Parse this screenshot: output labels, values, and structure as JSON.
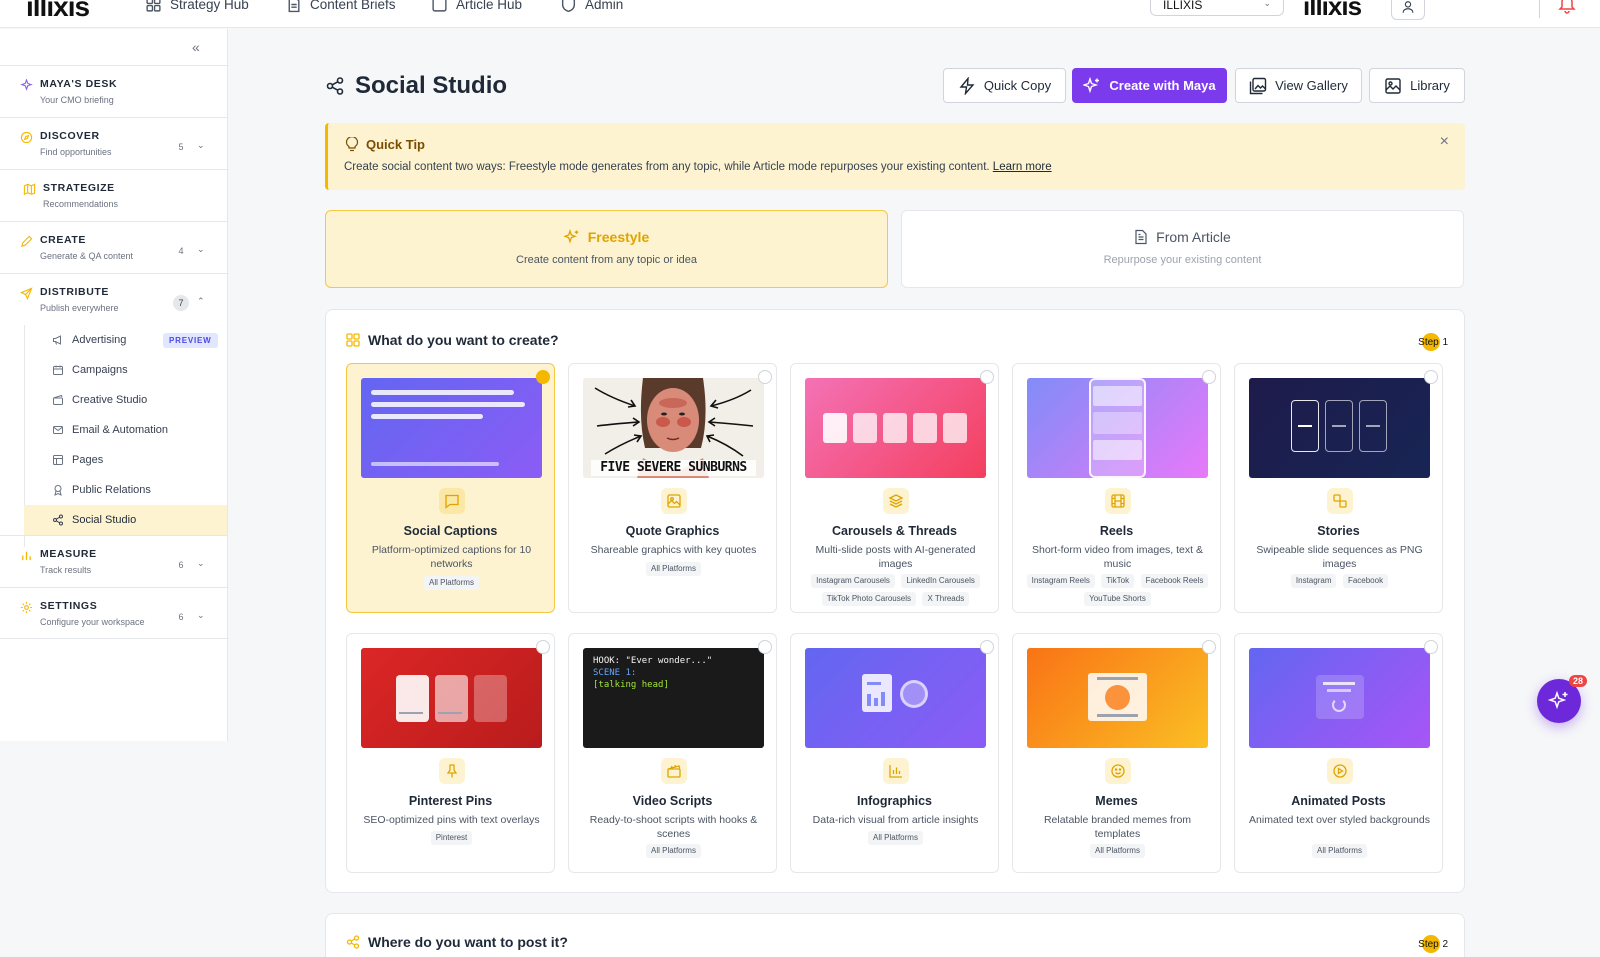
{
  "topnav": {
    "logo": "illixis",
    "items": [
      {
        "label": "Strategy Hub",
        "icon": "layout-grid-icon"
      },
      {
        "label": "Content Briefs",
        "icon": "document-icon"
      },
      {
        "label": "Article Hub",
        "icon": "square-icon"
      },
      {
        "label": "Admin",
        "icon": "shield-icon"
      }
    ],
    "workspace": "ILLIXIS",
    "brand": "illixis"
  },
  "sidebar": {
    "sections": [
      {
        "title": "MAYA'S DESK",
        "sub": "Your CMO briefing"
      },
      {
        "title": "DISCOVER",
        "sub": "Find opportunities",
        "count": "5"
      },
      {
        "title": "STRATEGIZE",
        "sub": "Recommendations"
      },
      {
        "title": "CREATE",
        "sub": "Generate & QA content",
        "count": "4"
      },
      {
        "title": "DISTRIBUTE",
        "sub": "Publish everywhere",
        "count": "7"
      },
      {
        "title": "MEASURE",
        "sub": "Track results",
        "count": "6"
      },
      {
        "title": "SETTINGS",
        "sub": "Configure your workspace",
        "count": "6"
      }
    ],
    "distribute_items": [
      {
        "label": "Advertising",
        "badge": "PREVIEW"
      },
      {
        "label": "Campaigns"
      },
      {
        "label": "Creative Studio"
      },
      {
        "label": "Email & Automation"
      },
      {
        "label": "Pages"
      },
      {
        "label": "Public Relations"
      },
      {
        "label": "Social Studio"
      }
    ]
  },
  "header": {
    "title": "Social Studio",
    "buttons": {
      "quick_copy": "Quick Copy",
      "create_maya": "Create with Maya",
      "view_gallery": "View Gallery",
      "library": "Library"
    }
  },
  "tip": {
    "title": "Quick Tip",
    "text": "Create social content two ways: Freestyle mode generates from any topic, while Article mode repurposes your existing content.",
    "link": "Learn more"
  },
  "modes": {
    "freestyle": {
      "title": "Freestyle",
      "sub": "Create content from any topic or idea"
    },
    "article": {
      "title": "From Article",
      "sub": "Repurpose your existing content"
    }
  },
  "create": {
    "heading": "What do you want to create?",
    "step_word": "Step",
    "step_num": "1",
    "tiles": [
      {
        "name": "Social Captions",
        "desc": "Platform-optimized captions for 10 networks",
        "tags": [
          "All Platforms"
        ]
      },
      {
        "name": "Quote Graphics",
        "desc": "Shareable graphics with key quotes",
        "tags": [
          "All Platforms"
        ],
        "thumb_caption": "FIVE SEVERE SUNBURNS"
      },
      {
        "name": "Carousels & Threads",
        "desc": "Multi-slide posts with AI-generated images",
        "tags": [
          "Instagram Carousels",
          "LinkedIn Carousels",
          "TikTok Photo Carousels",
          "X Threads"
        ]
      },
      {
        "name": "Reels",
        "desc": "Short-form video from images, text & music",
        "tags": [
          "Instagram Reels",
          "TikTok",
          "Facebook Reels",
          "YouTube Shorts"
        ]
      },
      {
        "name": "Stories",
        "desc": "Swipeable slide sequences as PNG images",
        "tags": [
          "Instagram",
          "Facebook"
        ]
      },
      {
        "name": "Pinterest Pins",
        "desc": "SEO-optimized pins with text overlays",
        "tags": [
          "Pinterest"
        ]
      },
      {
        "name": "Video Scripts",
        "desc": "Ready-to-shoot scripts with hooks & scenes",
        "tags": [
          "All Platforms"
        ],
        "script_lines": [
          "HOOK: \"Ever wonder...\"",
          "SCENE 1:",
          "[talking head]"
        ]
      },
      {
        "name": "Infographics",
        "desc": "Data-rich visual from article insights",
        "tags": [
          "All Platforms"
        ]
      },
      {
        "name": "Memes",
        "desc": "Relatable branded memes from templates",
        "tags": [
          "All Platforms"
        ]
      },
      {
        "name": "Animated Posts",
        "desc": "Animated text over styled backgrounds",
        "tags": [
          "All Platforms"
        ]
      }
    ]
  },
  "post": {
    "heading": "Where do you want to post it?",
    "step_word": "Step",
    "step_num": "2"
  },
  "fab": {
    "badge": "28"
  },
  "colors": {
    "accent": "#f5b800",
    "primary": "#7c3aed",
    "tip_bg": "#fdf3d0"
  }
}
